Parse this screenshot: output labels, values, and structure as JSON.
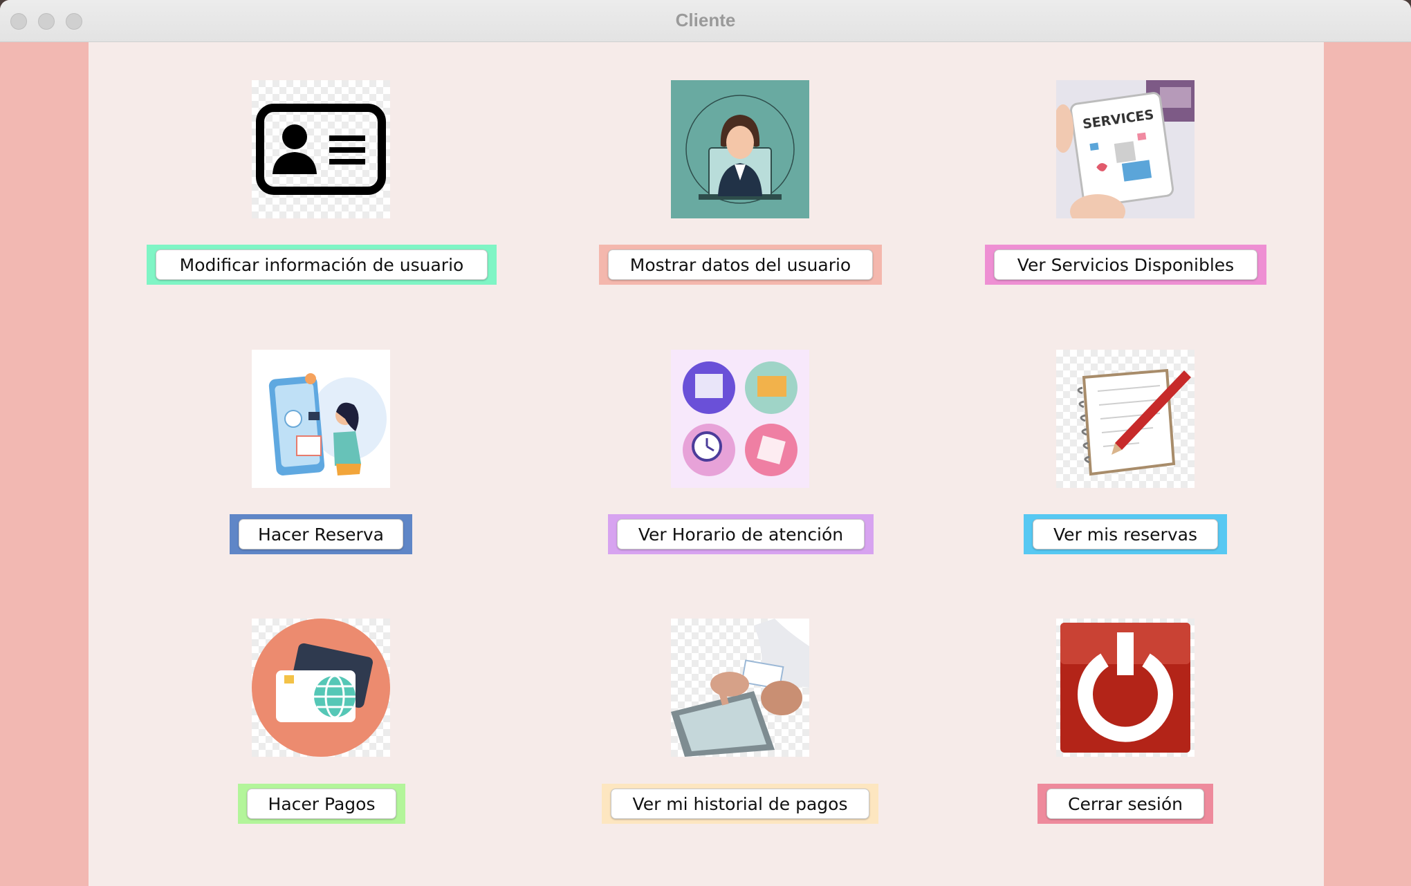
{
  "window": {
    "title": "Cliente"
  },
  "colors": {
    "side_bg": "#f2b8b2",
    "panel_bg": "#f6ebe9"
  },
  "tiles": [
    {
      "label": "Modificar información de usuario",
      "frame_color": "#7ff5c5",
      "icon": "id-card-icon"
    },
    {
      "label": "Mostrar datos del usuario",
      "frame_color": "#f4b7ad",
      "icon": "user-avatar-icon"
    },
    {
      "label": "Ver Servicios Disponibles",
      "frame_color": "#ee8fd3",
      "icon": "services-tablet-icon"
    },
    {
      "label": "Hacer Reserva",
      "frame_color": "#5f86c7",
      "icon": "booking-phone-icon"
    },
    {
      "label": "Ver Horario de atención",
      "frame_color": "#d7a3f0",
      "icon": "schedule-circles-icon"
    },
    {
      "label": "Ver mis reservas",
      "frame_color": "#57c8f2",
      "icon": "notebook-pen-icon"
    },
    {
      "label": "Hacer Pagos",
      "frame_color": "#b3f59a",
      "icon": "credit-card-icon"
    },
    {
      "label": "Ver mi historial de pagos",
      "frame_color": "#fde6c0",
      "icon": "tablet-payment-icon"
    },
    {
      "label": "Cerrar sesión",
      "frame_color": "#ee8a9c",
      "icon": "power-icon"
    }
  ]
}
